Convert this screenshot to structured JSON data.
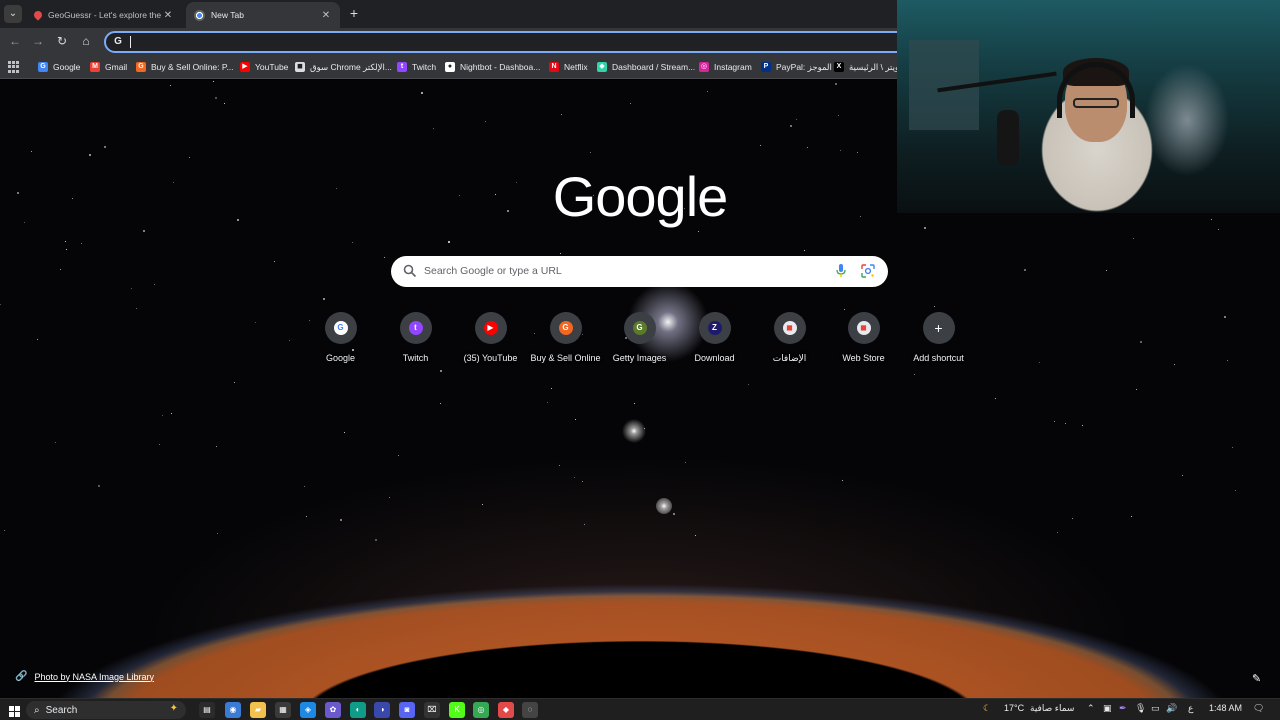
{
  "browser": {
    "tabs": [
      {
        "title": "GeoGuessr - Let's explore the w",
        "active": false
      },
      {
        "title": "New Tab",
        "active": true
      }
    ],
    "omnibox": {
      "value": ""
    },
    "bookmarks": [
      {
        "label": "Google",
        "icon": "google-icon",
        "color": "#4285f4",
        "glyph": "G"
      },
      {
        "label": "Gmail",
        "icon": "gmail-icon",
        "color": "#ea4335",
        "glyph": "M"
      },
      {
        "label": "Buy & Sell Online: P...",
        "icon": "g-orange-icon",
        "color": "#f26722",
        "glyph": "G"
      },
      {
        "label": "YouTube",
        "icon": "youtube-icon",
        "color": "#ff0000",
        "glyph": "▶"
      },
      {
        "label": "سوق Chrome الإلكتر...",
        "icon": "chrome-store-icon",
        "color": "#dadce0",
        "glyph": "◼"
      },
      {
        "label": "Twitch",
        "icon": "twitch-icon",
        "color": "#9146ff",
        "glyph": "t"
      },
      {
        "label": "Nightbot - Dashboa...",
        "icon": "nightbot-icon",
        "color": "#ffffff",
        "glyph": "●"
      },
      {
        "label": "Netflix",
        "icon": "netflix-icon",
        "color": "#e50914",
        "glyph": "N"
      },
      {
        "label": "Dashboard / Stream...",
        "icon": "streamelements-icon",
        "color": "#2fd4a8",
        "glyph": "◆"
      },
      {
        "label": "Instagram",
        "icon": "instagram-icon",
        "color": "#d6249f",
        "glyph": "◎"
      },
      {
        "label": "PayPal: الموجز",
        "icon": "paypal-icon",
        "color": "#003087",
        "glyph": "P"
      },
      {
        "label": "تويتر \\ الرئيسية",
        "icon": "x-icon",
        "color": "#000000",
        "glyph": "X"
      }
    ]
  },
  "ntp": {
    "logo": "Google",
    "search_placeholder": "Search Google or type a URL",
    "shortcuts": [
      {
        "label": "Google",
        "icon": "google-icon",
        "color": "#ffffff",
        "glyph": "G",
        "fg": "#4285f4"
      },
      {
        "label": "Twitch",
        "icon": "twitch-icon",
        "color": "#9146ff",
        "glyph": "t",
        "fg": "#ffffff"
      },
      {
        "label": "(35) YouTube",
        "icon": "youtube-icon",
        "color": "#ff0000",
        "glyph": "▶",
        "fg": "#ffffff"
      },
      {
        "label": "Buy & Sell Online",
        "icon": "g-orange-icon",
        "color": "#f26722",
        "glyph": "G",
        "fg": "#ffffff"
      },
      {
        "label": "Getty Images",
        "icon": "getty-icon",
        "color": "#5b7a2a",
        "glyph": "G",
        "fg": "#ffffff"
      },
      {
        "label": "Download",
        "icon": "zoom-z-icon",
        "color": "#1e1b6b",
        "glyph": "Z",
        "fg": "#ffffff"
      },
      {
        "label": "الإضافات",
        "icon": "chrome-store-icon",
        "color": "#e8eaed",
        "glyph": "◼",
        "fg": "#ea4335"
      },
      {
        "label": "Web Store",
        "icon": "chrome-store-icon",
        "color": "#e8eaed",
        "glyph": "◼",
        "fg": "#ea4335"
      },
      {
        "label": "Add shortcut",
        "icon": "plus-icon",
        "color": "#3c3f44",
        "glyph": "+",
        "fg": "#ffffff"
      }
    ],
    "photo_credit": "Photo by NASA Image Library"
  },
  "taskbar": {
    "search_label": "Search",
    "weather_temp": "17°C",
    "weather_desc": "سماء صافية",
    "lang": "ع",
    "time": "1:48 AM"
  }
}
